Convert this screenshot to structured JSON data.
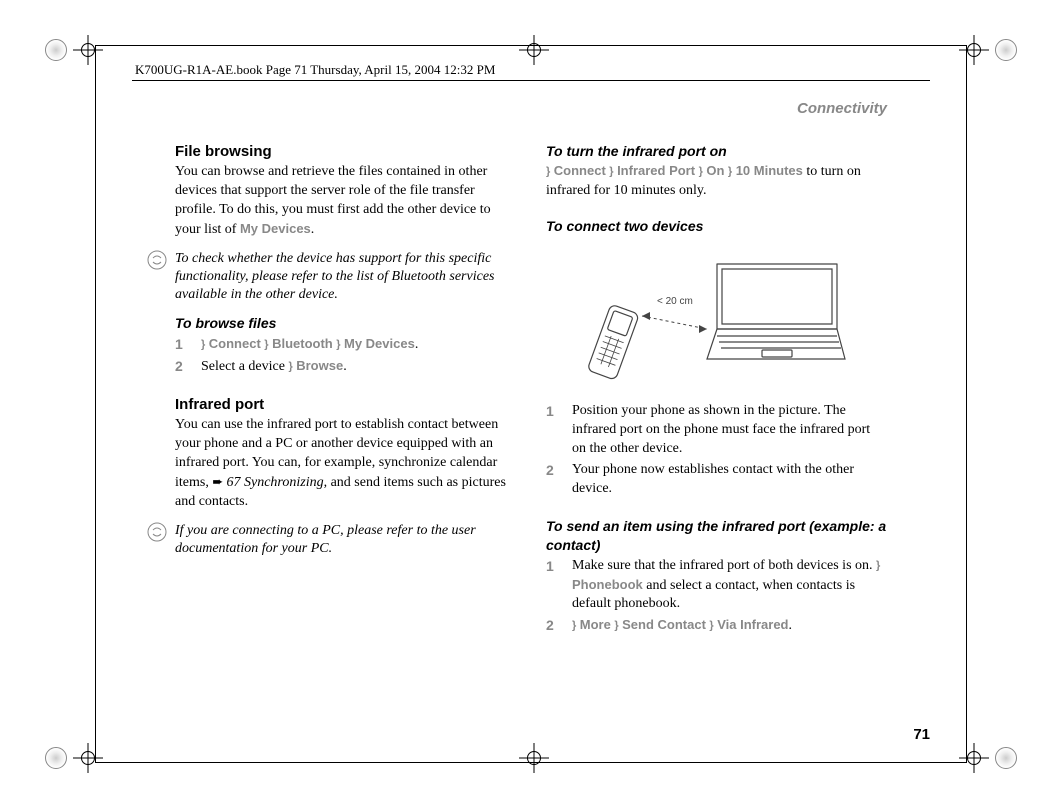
{
  "header": {
    "line": "K700UG-R1A-AE.book  Page 71  Thursday, April 15, 2004  12:32 PM"
  },
  "section_title": "Connectivity",
  "page_number": "71",
  "left": {
    "h1": "File browsing",
    "p1a": "You can browse and retrieve the files contained in other devices that support the server role of the file transfer profile. To do this, you must first add the other device to your list of ",
    "p1_softkey": "My Devices",
    "p1b": ".",
    "tip1": "To check whether the device has support for this specific functionality, please refer to the list of Bluetooth services available in the other device.",
    "h2": "To browse files",
    "step1_pre": "} ",
    "step1_sk1": "Connect",
    "step1_sk2": "Bluetooth",
    "step1_sk3": "My Devices",
    "step1_post": ".",
    "step2_pre": "Select a device ",
    "step2_sk1": "Browse",
    "step2_post": ".",
    "h3": "Infrared port",
    "p3a": "You can use the infrared port to establish contact between your phone and a PC or another device equipped with an infrared port. You can, for example, synchronize calendar items, ",
    "p3_xref": "67 Synchronizing",
    "p3b": ", and send items such as pictures and contacts.",
    "tip2": "If you are connecting to a PC, please refer to the user documentation for your PC."
  },
  "right": {
    "h1": "To turn the infrared port on",
    "p1_sk1": "Connect",
    "p1_sk2": "Infrared Port",
    "p1_sk3": "On",
    "p1_sk4": "10 Minutes",
    "p1_tail": " to turn on infrared for 10 minutes only.",
    "h2": "To connect two devices",
    "step1": "Position your phone as shown in the picture. The infrared port on the phone must face the infrared port on the other device.",
    "step2": "Your phone now establishes contact with the other device.",
    "h3": "To send an item using the infrared port (example: a contact)",
    "s3_step1a": "Make sure that the infrared port of both devices is on. ",
    "s3_step1_sk1": "Phonebook",
    "s3_step1b": " and select a contact, when contacts is default phonebook.",
    "s3_step2_sk1": "More",
    "s3_step2_sk2": "Send Contact",
    "s3_step2_sk3": "Via Infrared",
    "s3_step2_post": ".",
    "illustration_label": "< 20 cm"
  },
  "step_nums": {
    "n1": "1",
    "n2": "2"
  }
}
